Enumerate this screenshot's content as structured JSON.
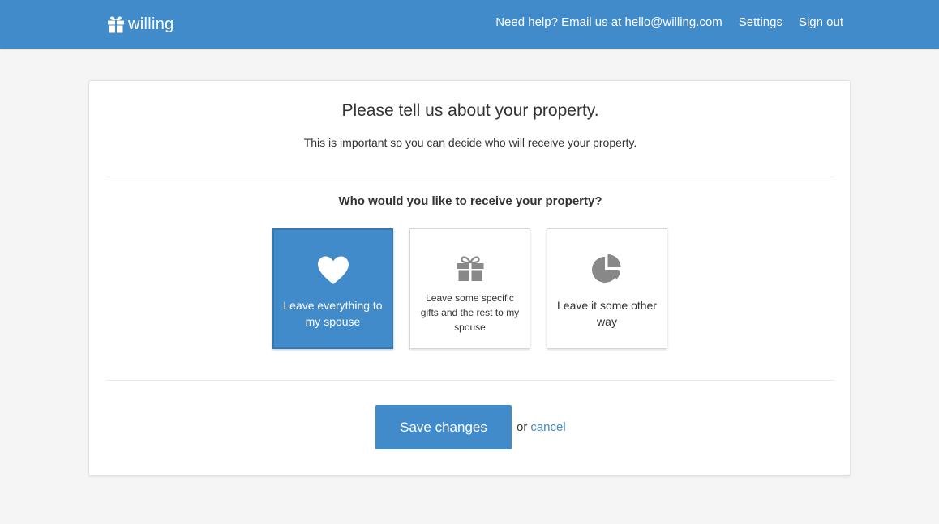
{
  "header": {
    "brand_name": "willing",
    "brand_icon": "gift-icon",
    "nav": {
      "help": "Need help? Email us at hello@willing.com",
      "settings": "Settings",
      "sign_out": "Sign out"
    },
    "background_color": "#428bca"
  },
  "main": {
    "title": "Please tell us about your property.",
    "subtitle": "This is important so you can decide who will receive your property.",
    "question": "Who would you like to receive your property?",
    "options": [
      {
        "label": "Leave everything to my spouse",
        "icon": "heart-icon",
        "selected": true
      },
      {
        "label": "Leave some specific gifts and the rest to my spouse",
        "icon": "gift-icon",
        "selected": false
      },
      {
        "label": "Leave it some other way",
        "icon": "pie-chart-icon",
        "selected": false
      }
    ],
    "actions": {
      "save_label": "Save changes",
      "or_text": "or",
      "cancel_label": "cancel"
    }
  },
  "colors": {
    "accent": "#428bca",
    "icon_gray": "#888888"
  }
}
